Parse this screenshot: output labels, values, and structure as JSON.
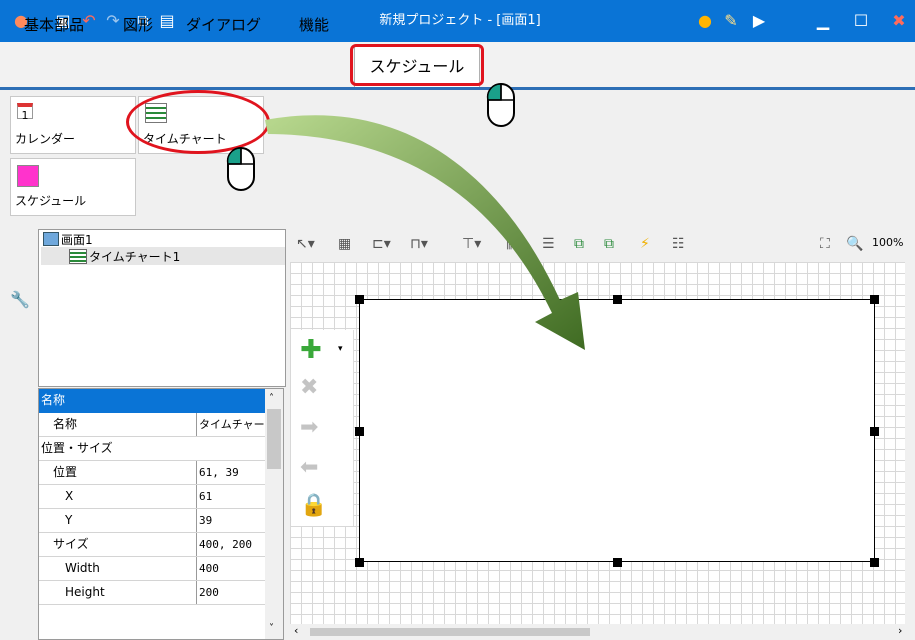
{
  "window": {
    "title": "新規プロジェクト - [画面1]"
  },
  "tabs": [
    "基本部品",
    "図形",
    "ダイアログ",
    "機能",
    "スケジュール"
  ],
  "ribbon": {
    "calendar_label": "カレンダー",
    "calendar_number": "1",
    "timechart_label": "タイムチャート",
    "schedule_label": "スケジュール"
  },
  "tree": {
    "screen": "画面1",
    "item": "タイムチャート1"
  },
  "properties": {
    "header": "名称",
    "name_label": "名称",
    "name_value": "タイムチャー",
    "group_label": "位置・サイズ",
    "position_label": "位置",
    "position_value": "61, 39",
    "x_label": "X",
    "x_value": "61",
    "y_label": "Y",
    "y_value": "39",
    "size_label": "サイズ",
    "size_value": "400, 200",
    "width_label": "Width",
    "width_value": "400",
    "height_label": "Height",
    "height_value": "200"
  },
  "zoom": "100%"
}
